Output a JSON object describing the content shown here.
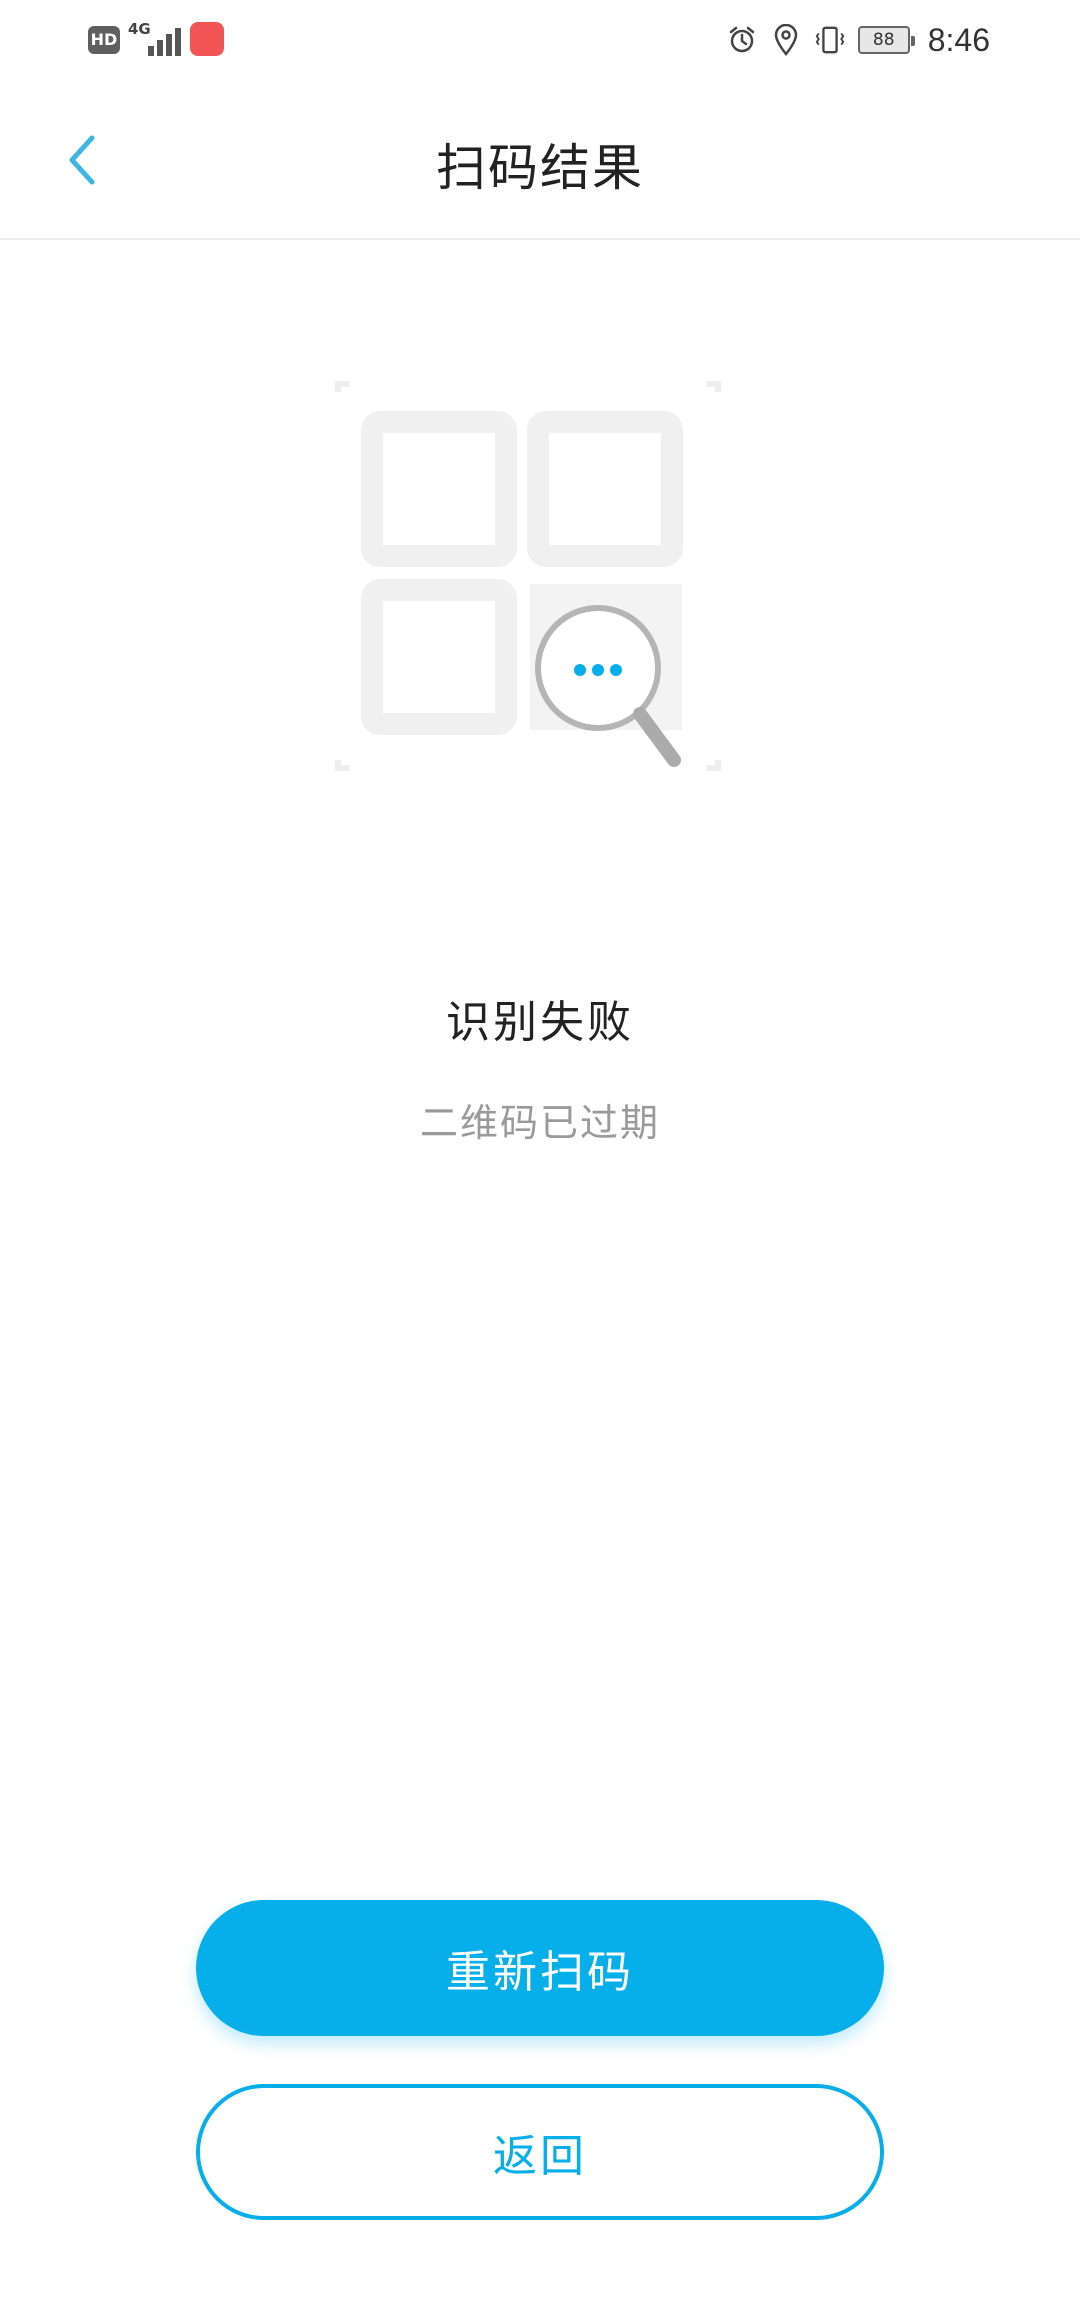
{
  "status_bar": {
    "hd_label": "HD",
    "network_label": "4G",
    "battery_level": "88",
    "time": "8:46",
    "icons": [
      "alarm-icon",
      "location-icon",
      "vibrate-icon"
    ]
  },
  "header": {
    "title": "扫码结果",
    "back_icon": "chevron-left-icon"
  },
  "illustration": {
    "icon": "qr-search-icon",
    "accent_color": "#06aeea"
  },
  "result": {
    "title": "识别失败",
    "subtitle": "二维码已过期"
  },
  "actions": {
    "rescan_label": "重新扫码",
    "back_label": "返回"
  },
  "colors": {
    "accent": "#06aeea",
    "title_text": "#222222",
    "subtitle_text": "#9a9a9a"
  }
}
